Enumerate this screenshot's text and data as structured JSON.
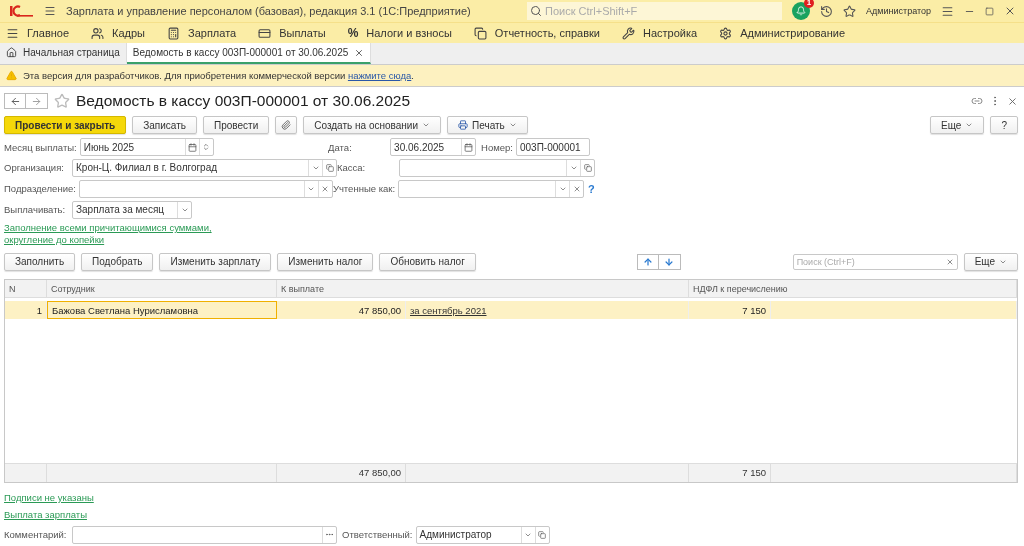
{
  "app": {
    "title": "Зарплата и управление персоналом (базовая), редакция 3.1  (1С:Предприятие)",
    "search_placeholder": "Поиск Ctrl+Shift+F",
    "notifications": "1",
    "user": "Администратор"
  },
  "sections": [
    {
      "label": "Главное"
    },
    {
      "label": "Кадры"
    },
    {
      "label": "Зарплата"
    },
    {
      "label": "Выплаты"
    },
    {
      "label": "Налоги и взносы",
      "symbol": "%"
    },
    {
      "label": "Отчетность, справки"
    },
    {
      "label": "Настройка"
    },
    {
      "label": "Администрирование"
    }
  ],
  "tabs": [
    {
      "label": "Начальная страница",
      "selected": false,
      "closable": false
    },
    {
      "label": "Ведомость в кассу 003П-000001 от 30.06.2025",
      "selected": true,
      "closable": true
    }
  ],
  "banner": {
    "text": "Эта версия для разработчиков. Для приобретения коммерческой версии ",
    "link": "нажмите сюда",
    "tail": "."
  },
  "document": {
    "title": "Ведомость в кассу 003П-000001 от 30.06.2025",
    "favorite": false
  },
  "toolbar": [
    {
      "label": "Провести и закрыть",
      "kind": "primary"
    },
    {
      "label": "Записать",
      "kind": "plain"
    },
    {
      "label": "Провести",
      "kind": "plain"
    },
    {
      "kind": "attach"
    },
    {
      "label": "Создать на основании",
      "kind": "menu"
    },
    {
      "label": "Печать",
      "kind": "print"
    }
  ],
  "toolbar_more": "Еще",
  "help": "?",
  "fields": {
    "month": {
      "label": "Месяц выплаты:",
      "value": "Июнь 2025"
    },
    "organization": {
      "label": "Организация:",
      "value": "Крон-Ц. Филиал в г. Волгоград"
    },
    "department": {
      "label": "Подразделение:"
    },
    "pay": {
      "label": "Выплачивать:",
      "value": "Зарплата за месяц"
    },
    "date": {
      "label": "Дата:",
      "value": "30.06.2025"
    },
    "number": {
      "label": "Номер:",
      "value": "003П-000001"
    },
    "cash": {
      "label": "Касса:"
    },
    "accounted": {
      "label": "Учтенные как:",
      "hint": "?"
    }
  },
  "fill_link": "Заполнение всеми причитающимися суммами, округление до копейки",
  "table_buttons": [
    "Заполнить",
    "Подобрать",
    "Изменить зарплату",
    "Изменить налог",
    "Обновить налог"
  ],
  "table_search": {
    "placeholder": "Поиск (Ctrl+F)"
  },
  "table_more": "Еще",
  "table": {
    "columns": [
      "N",
      "Сотрудник",
      "К выплате",
      "НДФЛ к перечислению"
    ],
    "rows": [
      {
        "n": "1",
        "employee": "Бажова Светлана Нурисламовна",
        "amount": "47 850,00",
        "period": "за сентябрь 2021",
        "tax": "7 150",
        "selected": true
      }
    ],
    "totals": {
      "amount": "47 850,00",
      "tax": "7 150"
    }
  },
  "footer_links": [
    "Подписи не указаны",
    "Выплата зарплаты"
  ],
  "comment": {
    "label": "Комментарий:"
  },
  "responsible": {
    "label": "Ответственный:",
    "value": "Администратор"
  }
}
